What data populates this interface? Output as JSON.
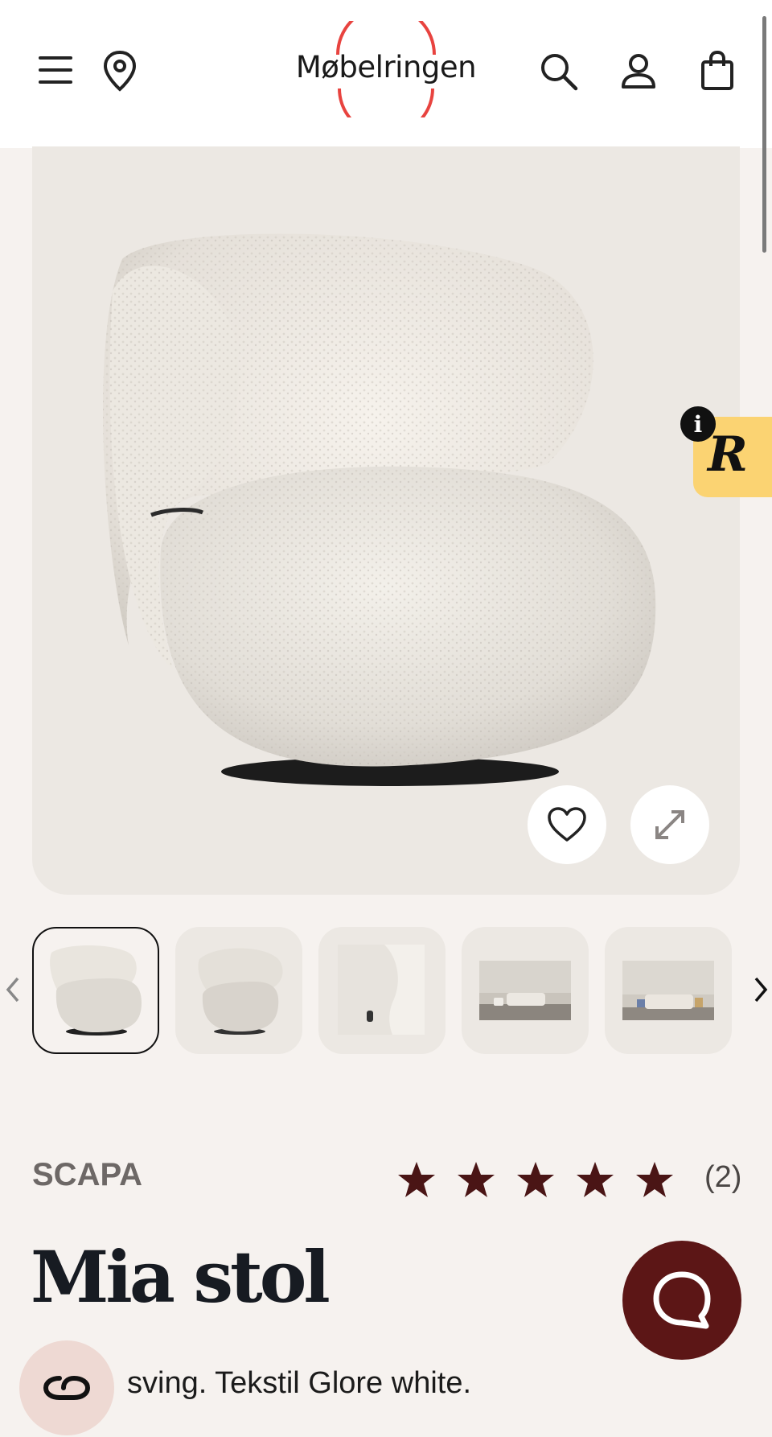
{
  "header": {
    "logo_text": "Møbelringen",
    "icons": [
      "menu-icon",
      "location-pin-icon",
      "search-icon",
      "account-icon",
      "shopping-bag-icon"
    ]
  },
  "product": {
    "brand": "SCAPA",
    "rating": 5,
    "rating_max": 5,
    "review_count": "(2)",
    "title": "Mia stol",
    "description_visible": "sving. Tekstil Glore white."
  },
  "gallery": {
    "thumbnail_count": 5,
    "active_index": 0
  },
  "colors": {
    "logo_ring": "#e8433f",
    "star": "#4a1515",
    "chat_button": "#5c1616",
    "badge": "#fbd372"
  },
  "badge_letter": "R",
  "badge_info": "i"
}
